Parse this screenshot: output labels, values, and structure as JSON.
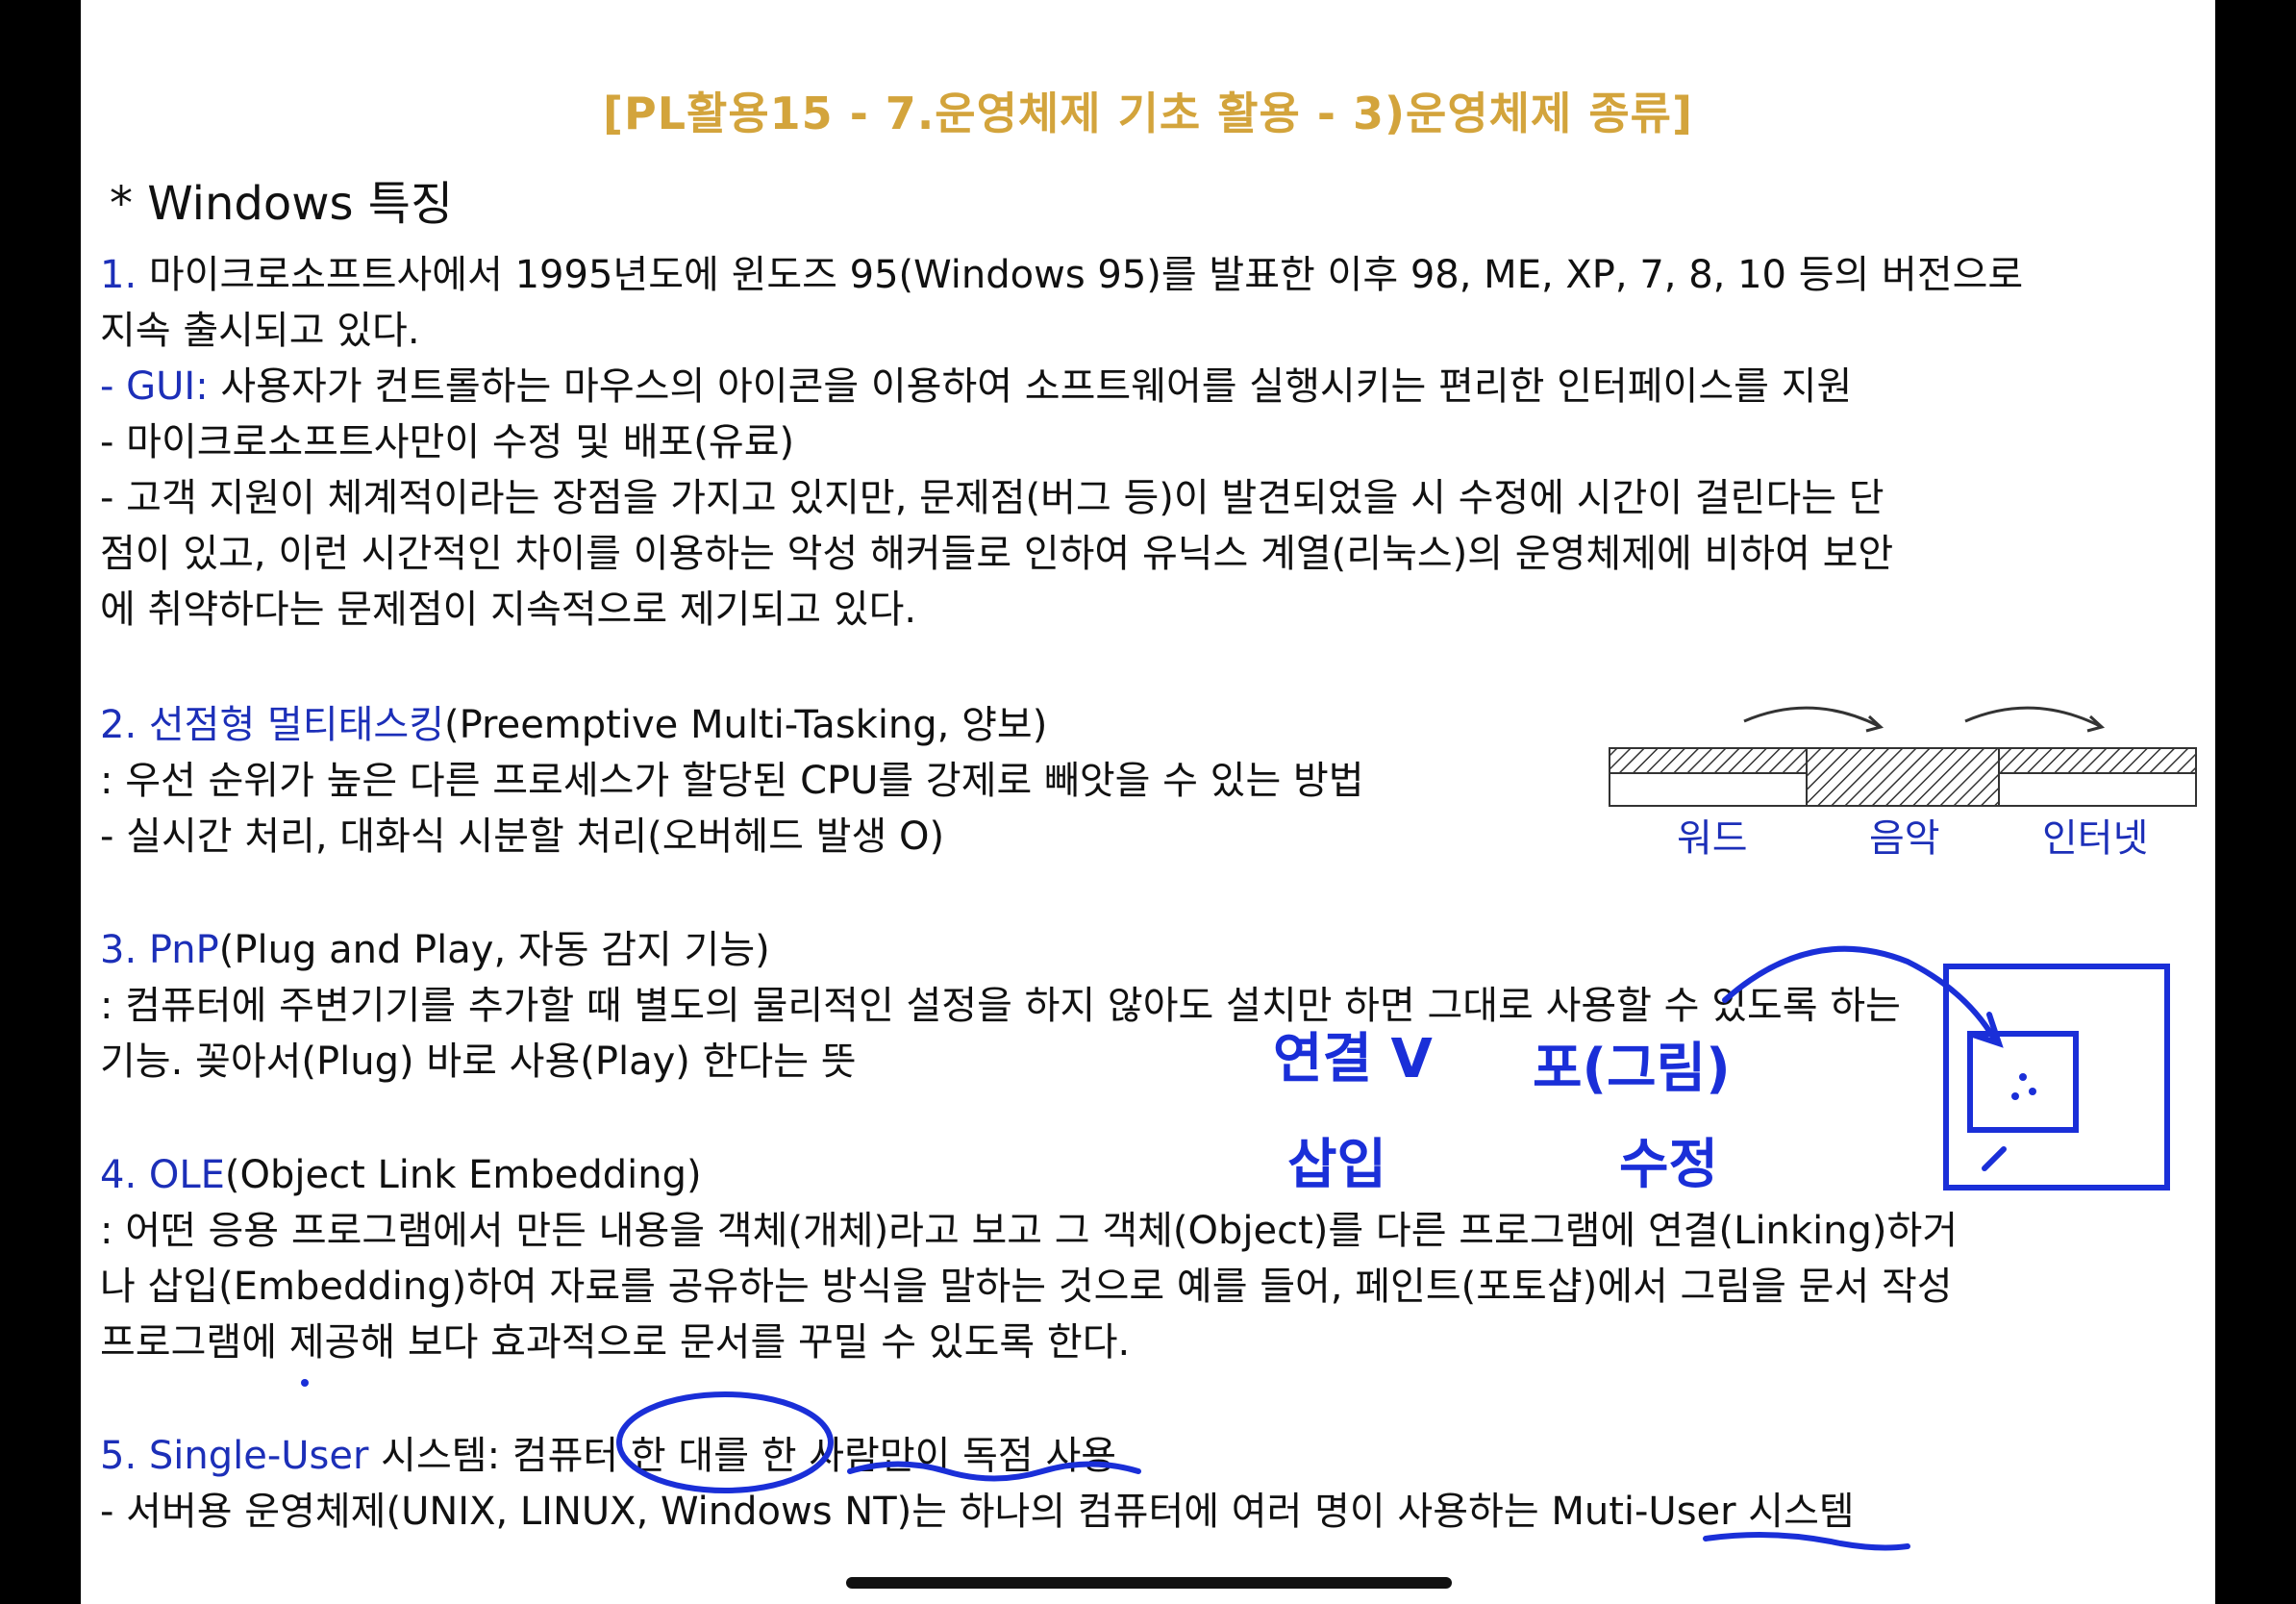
{
  "title": "[PL활용15 - 7.운영체제 기초 활용 - 3)운영체제 종류]",
  "heading": "* Windows 특징",
  "items": [
    {
      "number": "1.",
      "lines": [
        "마이크로소프트사에서 1995년도에 윈도즈 95(Windows 95)를 발표한 이후 98, ME, XP, 7, 8, 10 등의 버전으로",
        "지속 출시되고 있다."
      ],
      "gui_label": "- GUI:",
      "gui_text": "사용자가 컨트롤하는 마우스의 아이콘을 이용하여 소프트웨어를 실행시키는 편리한 인터페이스를 지원",
      "bullet2": "- 마이크로소프트사만이 수정 및 배포(유료)",
      "bullet3": [
        "- 고객 지원이 체계적이라는 장점을 가지고 있지만, 문제점(버그 등)이 발견되었을 시 수정에 시간이 걸린다는 단",
        "점이 있고, 이런 시간적인 차이를 이용하는 악성 해커들로 인하여 유닉스 계열(리눅스)의 운영체제에 비하여 보안",
        "에 취약하다는 문제점이 지속적으로 제기되고 있다."
      ]
    },
    {
      "title_blue": "2. 선점형 멀티태스킹",
      "title_rest": "(Preemptive Multi-Tasking, 양보)",
      "line1": ": 우선 순위가 높은 다른 프로세스가 할당된 CPU를 강제로 빼앗을 수 있는 방법",
      "line2": "- 실시간 처리, 대화식 시분할 처리(오버헤드 발생 O)"
    },
    {
      "title_blue": "3. PnP",
      "title_rest": "(Plug and Play, 자동 감지 기능)",
      "line1": ": 컴퓨터에 주변기기를 추가할 때 별도의 물리적인 설정을 하지 않아도 설치만 하면 그대로 사용할 수 있도록 하는",
      "line2": "기능. 꽂아서(Plug) 바로 사용(Play) 한다는 뜻"
    },
    {
      "title_blue": "4. OLE",
      "title_rest": "(Object Link Embedding)",
      "line1": ": 어떤 응용 프로그램에서 만든 내용을 객체(개체)라고 보고 그 객체(Object)를 다른 프로그램에 연결(Linking)하거",
      "line2": "나 삽입(Embedding)하여 자료를 공유하는 방식을 말하는 것으로 예를 들어, 페인트(포토샵)에서 그림을 문서 작성",
      "line3": "프로그램에 제공해 보다 효과적으로 문서를 꾸밀 수 있도록 한다."
    },
    {
      "title_blue": "5. Single-User",
      "title_rest": "시스템: 컴퓨터 한 대를 한 사람만이 독점 사용",
      "line1": "- 서버용 운영체제(UNIX, LINUX, Windows NT)는 하나의 컴퓨터에 여러 명이 사용하는 Muti-User 시스템"
    }
  ],
  "diagram": {
    "labels": [
      "워드",
      "음악",
      "인터넷"
    ]
  },
  "annotations": {
    "link": "연결 V",
    "link_sub": "삽입",
    "paste": "포(그림)",
    "paste_sub": "수정"
  },
  "colors": {
    "title": "#d3a43c",
    "blue_text": "#1c2fb8",
    "ink": "#1a2fd8"
  }
}
